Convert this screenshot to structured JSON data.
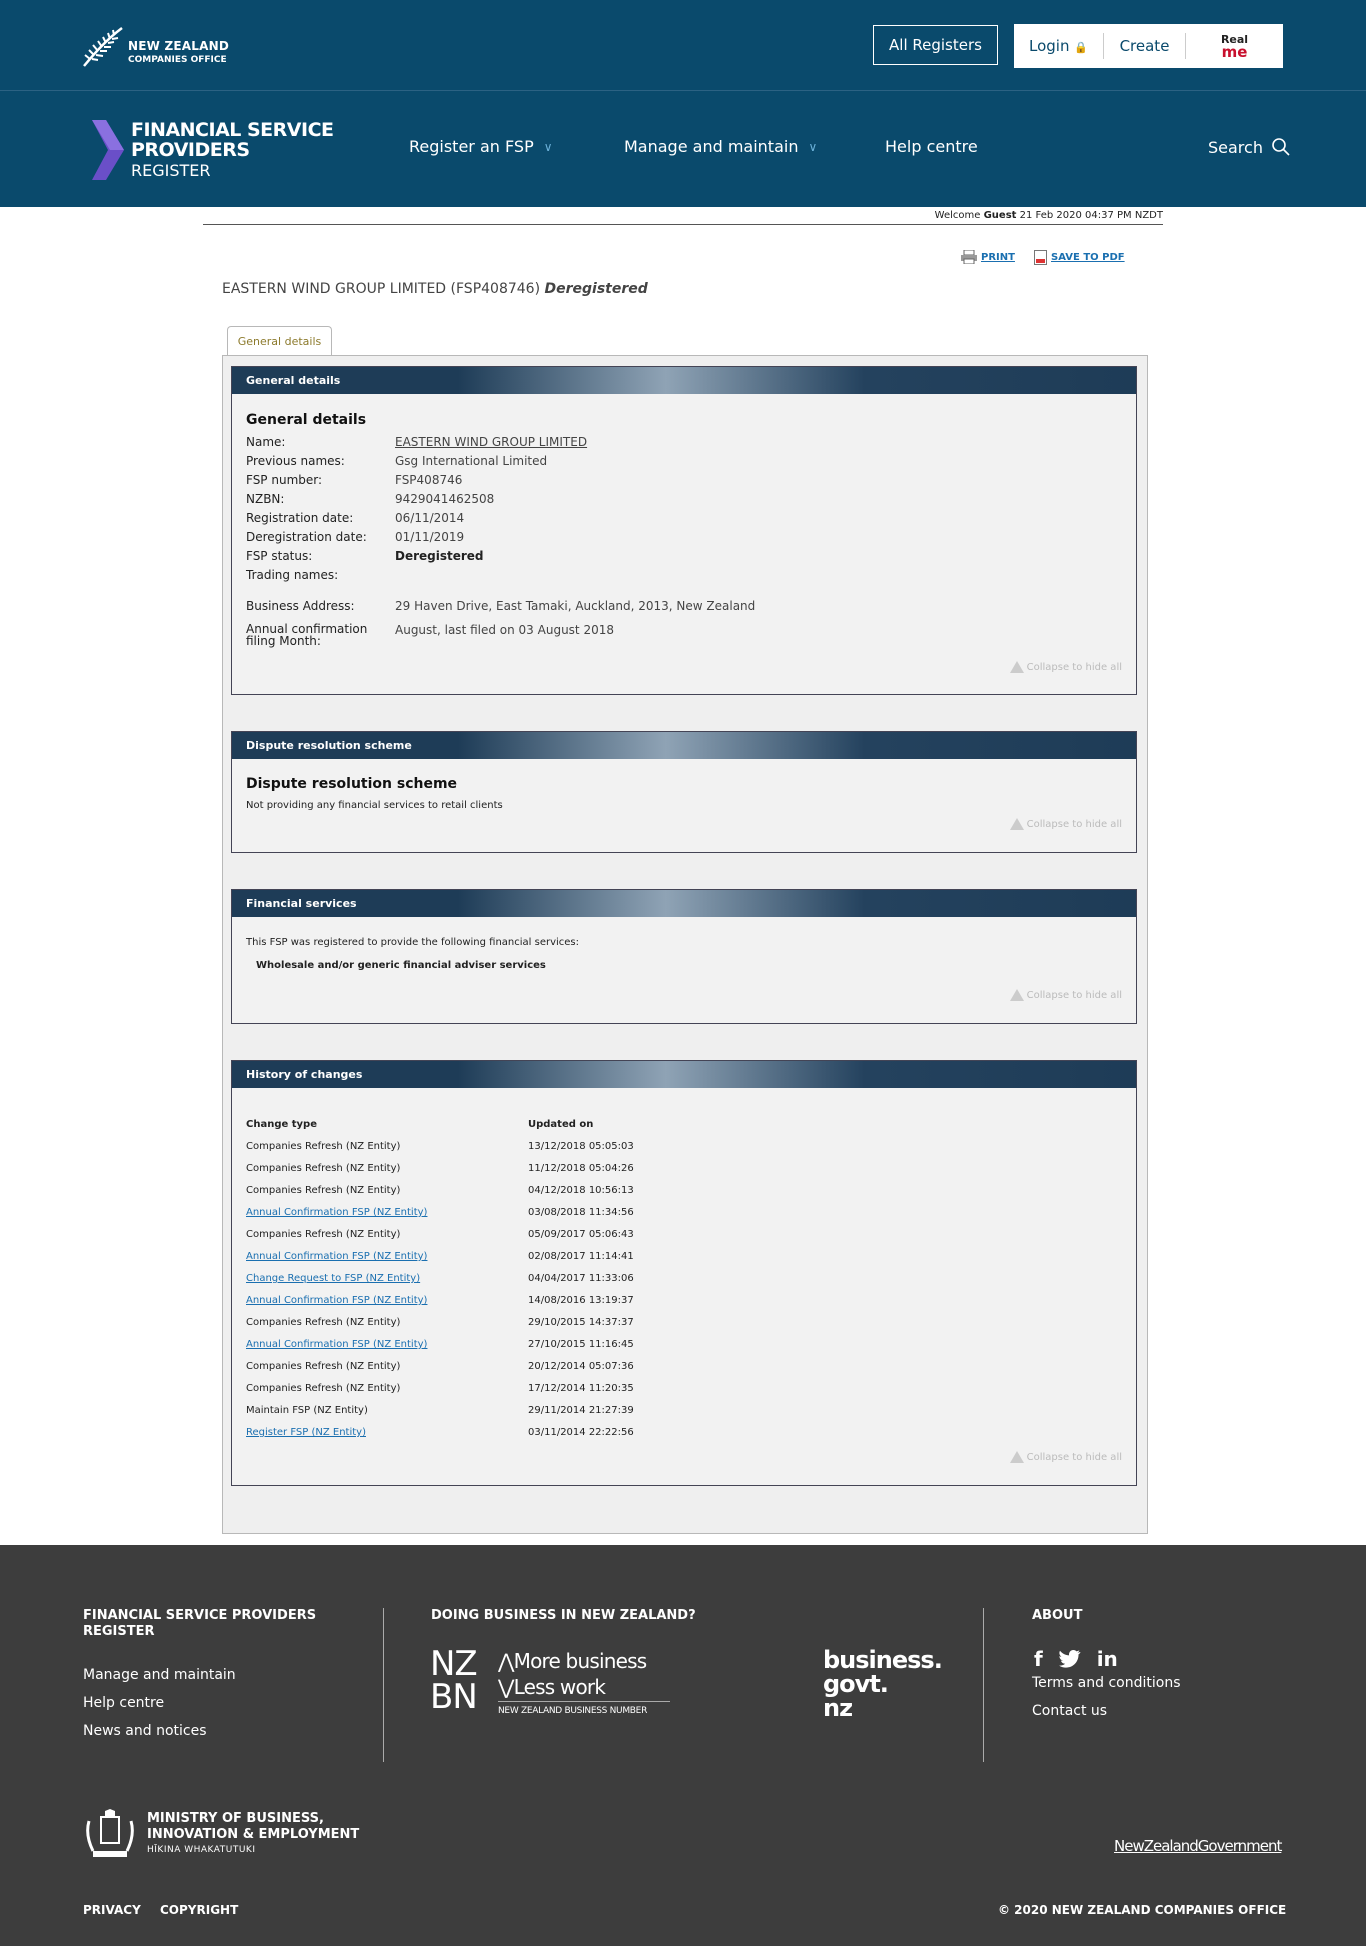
{
  "header": {
    "nzco_line1": "NEW ZEALAND",
    "nzco_line2": "COMPANIES OFFICE",
    "all_registers": "All Registers",
    "login": "Login",
    "create": "Create",
    "realme_line1": "Real",
    "realme_line2": "me",
    "fsp_line1": "FINANCIAL SERVICE",
    "fsp_line2": "PROVIDERS",
    "fsp_line3": "REGISTER",
    "nav": [
      "Register an FSP",
      "Manage and maintain",
      "Help centre"
    ],
    "search": "Search"
  },
  "welcome": {
    "prefix": "Welcome ",
    "user": "Guest",
    "datetime": " 21 Feb 2020 04:37 PM NZDT"
  },
  "tools": {
    "print": "PRINT",
    "save_pdf": "SAVE TO PDF"
  },
  "page_title": {
    "name": "EASTERN WIND GROUP LIMITED (FSP408746)",
    "status": "Deregistered"
  },
  "tab": "General details",
  "collapse_label": "Collapse to hide all",
  "general": {
    "bar": "General details",
    "heading": "General details",
    "rows": [
      {
        "k": "Name:",
        "v": "EASTERN WIND GROUP LIMITED"
      },
      {
        "k": "Previous names:",
        "v": "Gsg International Limited"
      },
      {
        "k": "FSP number:",
        "v": "FSP408746"
      },
      {
        "k": "NZBN:",
        "v": "9429041462508"
      },
      {
        "k": "Registration date:",
        "v": "06/11/2014"
      },
      {
        "k": "Deregistration date:",
        "v": "01/11/2019"
      },
      {
        "k": "FSP status:",
        "v": "Deregistered"
      },
      {
        "k": "Trading names:",
        "v": ""
      }
    ],
    "business_address_label": "Business Address:",
    "business_address": "29 Haven Drive, East Tamaki, Auckland, 2013, New Zealand",
    "annual_label_1": "Annual confirmation",
    "annual_label_2": "filing Month:",
    "annual_value": "August, last filed on 03 August 2018"
  },
  "dispute": {
    "bar": "Dispute resolution scheme",
    "heading": "Dispute resolution scheme",
    "text": "Not providing any financial services to retail clients"
  },
  "services": {
    "bar": "Financial services",
    "intro": "This FSP was registered to provide the following financial services:",
    "item": "Wholesale and/or generic financial adviser services"
  },
  "history": {
    "bar": "History of changes",
    "col1": "Change type",
    "col2": "Updated on",
    "rows": [
      {
        "type": "Companies Refresh (NZ Entity)",
        "date": "13/12/2018 05:05:03"
      },
      {
        "type": "Companies Refresh (NZ Entity)",
        "date": "11/12/2018 05:04:26"
      },
      {
        "type": "Companies Refresh (NZ Entity)",
        "date": "04/12/2018 10:56:13"
      },
      {
        "type": "Annual Confirmation FSP (NZ Entity)",
        "date": "03/08/2018 11:34:56"
      },
      {
        "type": "Companies Refresh (NZ Entity)",
        "date": "05/09/2017 05:06:43"
      },
      {
        "type": "Annual Confirmation FSP (NZ Entity)",
        "date": "02/08/2017 11:14:41"
      },
      {
        "type": "Change Request to FSP (NZ Entity)",
        "date": "04/04/2017 11:33:06"
      },
      {
        "type": "Annual Confirmation FSP (NZ Entity)",
        "date": "14/08/2016 13:19:37"
      },
      {
        "type": "Companies Refresh (NZ Entity)",
        "date": "29/10/2015 14:37:37"
      },
      {
        "type": "Annual Confirmation FSP (NZ Entity)",
        "date": "27/10/2015 11:16:45"
      },
      {
        "type": "Companies Refresh (NZ Entity)",
        "date": "20/12/2014 05:07:36"
      },
      {
        "type": "Companies Refresh (NZ Entity)",
        "date": "17/12/2014 11:20:35"
      },
      {
        "type": "Maintain FSP (NZ Entity)",
        "date": "29/11/2014 21:27:39"
      },
      {
        "type": "Register FSP (NZ Entity)",
        "date": "03/11/2014 22:22:56"
      }
    ]
  },
  "footer": {
    "col1_heading_1": "FINANCIAL SERVICE PROVIDERS",
    "col1_heading_2": "REGISTER",
    "col1_links": [
      "Manage and maintain",
      "Help centre",
      "News and notices"
    ],
    "col2_heading": "DOING BUSINESS IN NEW ZEALAND?",
    "nzbn_nz": "NZ",
    "nzbn_bn": "BN",
    "nzbn_more": "More business",
    "nzbn_less": "Less work",
    "nzbn_sub": "NEW ZEALAND BUSINESS NUMBER",
    "bg_line1": "business.",
    "bg_line2": "govt.",
    "bg_line3": "nz",
    "col3_heading": "ABOUT",
    "col3_links": [
      "Terms and conditions",
      "Contact us"
    ],
    "mbie_line1": "MINISTRY OF BUSINESS,",
    "mbie_line2": "INNOVATION & EMPLOYMENT",
    "mbie_line3": "HĪKINA WHAKATUTUKI",
    "nzgovt": "NewZealandGovernment",
    "privacy": "PRIVACY",
    "copyright": "COPYRIGHT",
    "copy_right": "© 2020 NEW ZEALAND COMPANIES OFFICE"
  }
}
